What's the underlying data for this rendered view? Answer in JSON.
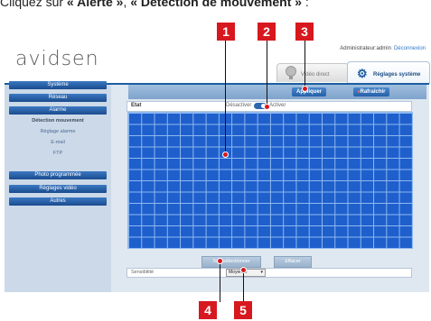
{
  "caption": {
    "prefix": "Cliquez sur ",
    "alerte": "« Alerte »",
    "sep": ", ",
    "detection": "« Détection de mouvement »",
    "suffix": " :"
  },
  "header": {
    "logo": "avidsen",
    "admin_text": "Administrateur:admin",
    "logout": "Déconnexion"
  },
  "tabs": {
    "live": "Vidéo direct",
    "settings": "Réglages système"
  },
  "sidebar": {
    "top_buttons": [
      "Système",
      "Réseau",
      "Alarme"
    ],
    "section_title": "Détection mouvement",
    "sub_items": [
      "Réglage alarme",
      "E-mail",
      "FTP"
    ],
    "bottom_buttons": [
      "Photo programmée",
      "Réglages vidéo",
      "Autres"
    ]
  },
  "toolbar": {
    "save": "Appliquer",
    "refresh": "Rafraîchir"
  },
  "state_row": {
    "label": "Etat",
    "off": "Désactiver",
    "on": "Activer"
  },
  "bottom_buttons": {
    "select_all": "Tout sélectionner",
    "clear": "Effacer"
  },
  "sensitivity": {
    "label": "Sensibilité",
    "value": "Moyenne"
  },
  "markers": [
    "1",
    "2",
    "3",
    "4",
    "5"
  ],
  "colors": {
    "accent": "#1d5ea0",
    "grid": "#1e5fcc",
    "marker": "#d7181f"
  }
}
